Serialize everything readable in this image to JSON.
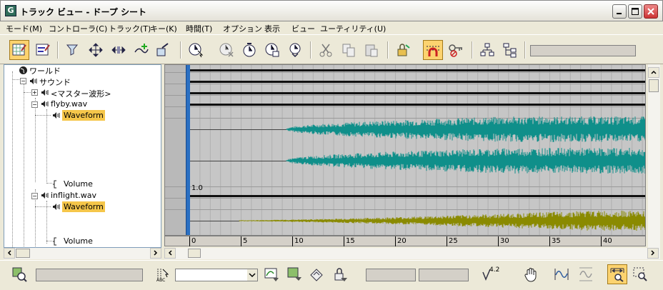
{
  "window": {
    "title": "トラック ビュー - ドープ シート",
    "icon": "trackview-app-icon"
  },
  "menu": [
    {
      "label": "モード(M)"
    },
    {
      "label": "コントローラ(C)"
    },
    {
      "label": "トラック(T)"
    },
    {
      "label": "キー(K)"
    },
    {
      "label": "時間(T)"
    },
    {
      "label": "オプション"
    },
    {
      "label": "表示"
    },
    {
      "label": "ビュー"
    },
    {
      "label": "ユーティリティ(U)"
    }
  ],
  "tree": {
    "items": [
      {
        "label": "ワールド",
        "icon": "globe-icon"
      },
      {
        "label": "サウンド",
        "icon": "speaker-icon"
      },
      {
        "label": "<マスター波形>",
        "icon": "speaker-icon"
      },
      {
        "label": "flyby.wav",
        "icon": "speaker-icon"
      },
      {
        "label": "Waveform",
        "icon": "speaker-icon",
        "selected": true
      },
      {
        "label": "Volume",
        "icon": "bracket-icon"
      },
      {
        "label": "inflight.wav",
        "icon": "speaker-icon"
      },
      {
        "label": "Waveform",
        "icon": "speaker-icon",
        "selected": true
      },
      {
        "label": "Volume",
        "icon": "bracket-icon"
      }
    ]
  },
  "graph": {
    "volume_value": "1.0",
    "colors": {
      "flyby_wave": "#0f8f8a",
      "inflight_wave": "#8a8a00",
      "time_slider": "#2a6fc2",
      "selection": "#f5c64a"
    }
  },
  "timeline": {
    "ticks": [
      "0",
      "5",
      "10",
      "15",
      "20",
      "25",
      "30",
      "35",
      "40"
    ]
  },
  "bottom": {
    "key_value_label": "4.2"
  }
}
